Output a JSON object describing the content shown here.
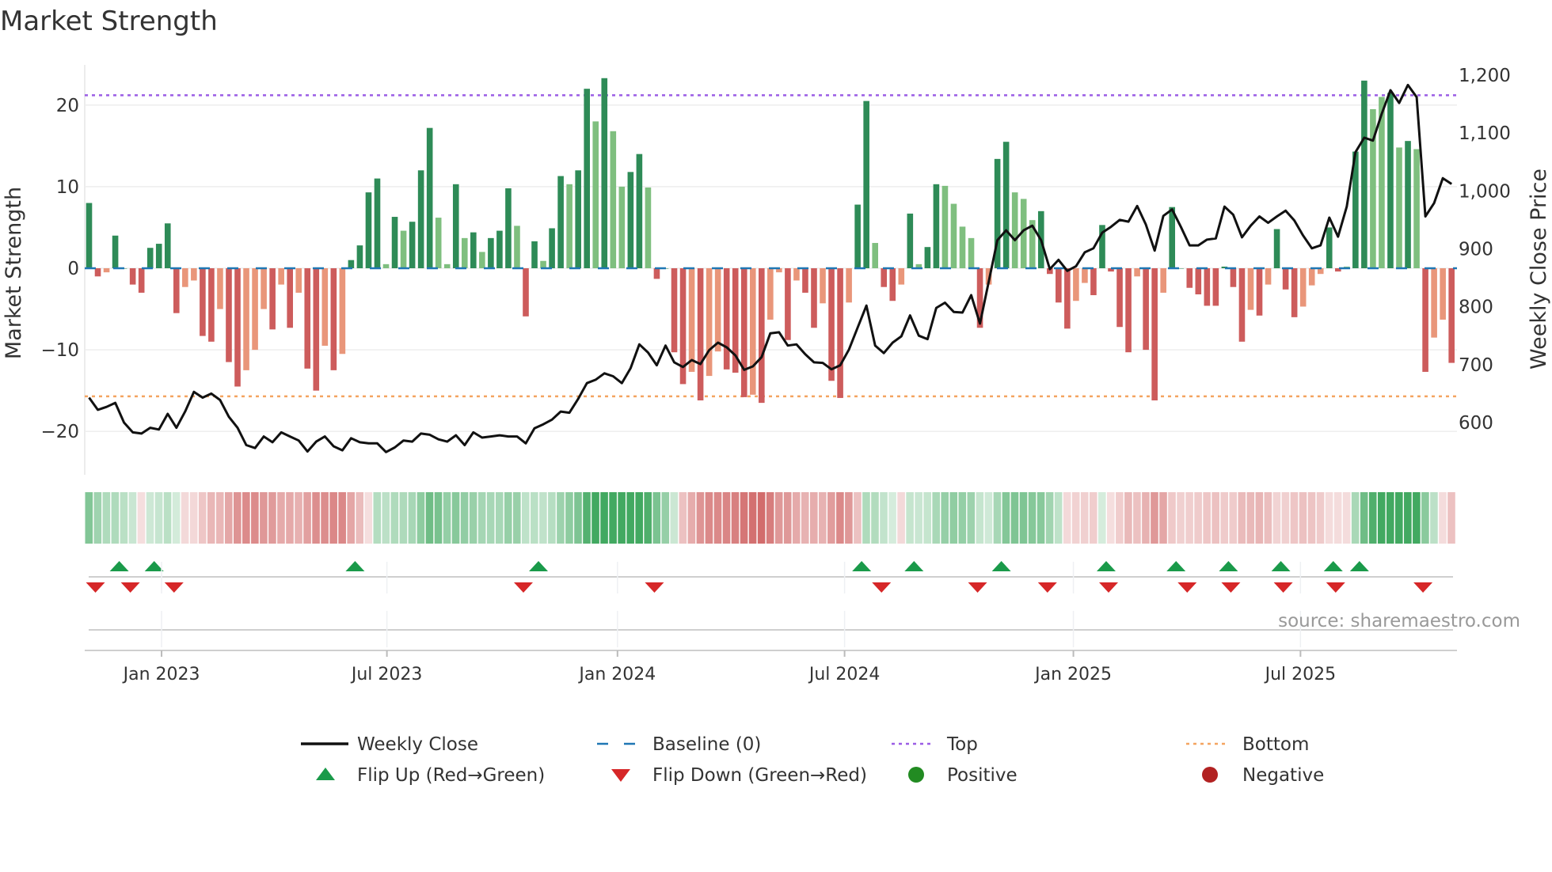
{
  "chart_data": {
    "type": "bar",
    "title": "Market Strength",
    "ylabel": "Market Strength",
    "y2label": "Weekly Close Price",
    "ylim": [
      -25,
      24
    ],
    "y2lim": [
      520,
      1223
    ],
    "yticks": [
      {
        "v": -20,
        "label": "−20"
      },
      {
        "v": -10,
        "label": "−10"
      },
      {
        "v": 0,
        "label": "0"
      },
      {
        "v": 10,
        "label": "10"
      },
      {
        "v": 20,
        "label": "20"
      }
    ],
    "y2ticks": [
      {
        "v": 600,
        "label": "600"
      },
      {
        "v": 700,
        "label": "700"
      },
      {
        "v": 800,
        "label": "800"
      },
      {
        "v": 900,
        "label": "900"
      },
      {
        "v": 1000,
        "label": "1,000"
      },
      {
        "v": 1100,
        "label": "1,100"
      },
      {
        "v": 1200,
        "label": "1,200"
      }
    ],
    "xticks": [
      {
        "week": 8.3,
        "label": "Jan 2023"
      },
      {
        "week": 34.1,
        "label": "Jul 2023"
      },
      {
        "week": 60.5,
        "label": "Jan 2024"
      },
      {
        "week": 86.5,
        "label": "Jul 2024"
      },
      {
        "week": 112.7,
        "label": "Jan 2025"
      },
      {
        "week": 138.7,
        "label": "Jul 2025"
      }
    ],
    "top_level": 21.2,
    "bottom_level": -15.7,
    "baseline": 0,
    "strength": [
      8,
      -1,
      -0.5,
      4,
      0,
      -2,
      -3,
      2.5,
      3,
      5.5,
      -5.5,
      -2.3,
      -1.5,
      -8.3,
      -9,
      -5,
      -11.5,
      -14.5,
      -12.5,
      -10,
      -5,
      -7.5,
      -2,
      -7.3,
      -3,
      -12.3,
      -15,
      -9.5,
      -12.5,
      -10.5,
      1,
      2.8,
      9.3,
      11,
      0.5,
      6.3,
      4.6,
      5.7,
      12,
      17.2,
      6.2,
      0.5,
      10.3,
      3.7,
      4.4,
      2,
      3.7,
      4.6,
      9.8,
      5.2,
      -5.9,
      3.3,
      0.9,
      4.9,
      11.3,
      10.3,
      12,
      22,
      18,
      23.3,
      16.8,
      10,
      11.8,
      14,
      9.9,
      -1.3,
      0,
      -10.3,
      -14.2,
      -12.7,
      -16.2,
      -13.2,
      -10.2,
      -12.4,
      -12.8,
      -15.8,
      -15.5,
      -16.5,
      -6.3,
      -0.5,
      -8.8,
      -1.5,
      -3,
      -7.3,
      -4.3,
      -13.8,
      -15.9,
      -4.2,
      7.8,
      20.5,
      3.1,
      -2.3,
      -4,
      -2,
      6.7,
      0.5,
      2.6,
      10.3,
      10.1,
      7.9,
      5.1,
      3.7,
      -7.3,
      -2,
      13.4,
      15.5,
      9.3,
      8.5,
      5.9,
      7,
      -0.7,
      -4.2,
      -7.4,
      -4,
      -1.8,
      -3.3,
      5.3,
      -0.4,
      -7.2,
      -10.3,
      -1,
      -10,
      -16.2,
      -3,
      7.5,
      0,
      -2.4,
      -3.2,
      -4.6,
      -4.6,
      0.2,
      -2.3,
      -9,
      -5.1,
      -5.8,
      -2,
      4.8,
      -2.6,
      -6,
      -4.7,
      -2.1,
      -0.7,
      5,
      -0.4,
      0.2,
      14.3,
      23,
      19.5,
      21,
      21.5,
      14.8,
      15.6,
      14.6,
      -12.7,
      -8.5,
      -6.3,
      -11.6
    ],
    "strong": [
      1,
      1,
      0,
      1,
      1,
      1,
      1,
      1,
      1,
      1,
      1,
      0,
      0,
      1,
      1,
      0,
      1,
      1,
      0,
      0,
      0,
      1,
      0,
      1,
      0,
      1,
      1,
      0,
      1,
      0,
      1,
      1,
      1,
      1,
      0,
      1,
      0,
      1,
      1,
      1,
      0,
      0,
      1,
      0,
      1,
      0,
      1,
      1,
      1,
      0,
      1,
      1,
      0,
      1,
      1,
      0,
      1,
      1,
      0,
      1,
      0,
      0,
      1,
      1,
      0,
      1,
      1,
      1,
      1,
      0,
      1,
      0,
      0,
      1,
      1,
      1,
      0,
      1,
      0,
      0,
      1,
      0,
      1,
      1,
      0,
      1,
      1,
      0,
      1,
      1,
      0,
      1,
      1,
      0,
      1,
      0,
      1,
      1,
      0,
      0,
      0,
      0,
      1,
      0,
      1,
      1,
      0,
      0,
      0,
      1,
      1,
      1,
      1,
      0,
      0,
      1,
      1,
      1,
      1,
      1,
      0,
      1,
      1,
      0,
      1,
      1,
      1,
      1,
      1,
      1,
      1,
      1,
      1,
      0,
      1,
      0,
      1,
      1,
      1,
      0,
      0,
      0,
      1,
      1,
      0,
      1,
      1,
      0,
      0,
      1,
      0,
      1,
      0,
      1,
      0,
      0,
      1
    ],
    "weekly_close": [
      643,
      622,
      627,
      634,
      600,
      583,
      581,
      591,
      588,
      615,
      591,
      619,
      653,
      643,
      650,
      639,
      610,
      591,
      561,
      556,
      576,
      566,
      583,
      576,
      569,
      550,
      567,
      576,
      559,
      552,
      573,
      566,
      564,
      564,
      549,
      557,
      569,
      567,
      581,
      579,
      571,
      567,
      578,
      561,
      583,
      574,
      576,
      578,
      576,
      576,
      564,
      590,
      597,
      605,
      619,
      617,
      641,
      668,
      674,
      685,
      680,
      668,
      694,
      735,
      721,
      699,
      733,
      704,
      696,
      708,
      701,
      725,
      738,
      730,
      716,
      691,
      697,
      713,
      754,
      756,
      733,
      735,
      718,
      704,
      703,
      692,
      699,
      726,
      764,
      802,
      733,
      720,
      738,
      749,
      785,
      750,
      744,
      798,
      807,
      791,
      790,
      820,
      771,
      843,
      915,
      932,
      915,
      932,
      940,
      915,
      865,
      881,
      862,
      870,
      894,
      901,
      928,
      938,
      950,
      947,
      974,
      942,
      897,
      957,
      968,
      938,
      906,
      906,
      916,
      918,
      973,
      959,
      920,
      940,
      956,
      945,
      956,
      966,
      949,
      923,
      901,
      906,
      954,
      921,
      973,
      1067,
      1092,
      1087,
      1133,
      1174,
      1152,
      1183,
      1162,
      956,
      979,
      1022,
      1012
    ],
    "flip_up_weeks": [
      3,
      7,
      30,
      51,
      88,
      94,
      104,
      116,
      124,
      130,
      136,
      142,
      145
    ],
    "flip_down_weeks": [
      1,
      5,
      10,
      50,
      65,
      91,
      102,
      110,
      117,
      126,
      131,
      137,
      143,
      153
    ],
    "legend": [
      {
        "label": "Weekly Close",
        "kind": "line"
      },
      {
        "label": "Baseline (0)",
        "kind": "dash"
      },
      {
        "label": "Top",
        "kind": "dot-top"
      },
      {
        "label": "Bottom",
        "kind": "dot-bottom"
      },
      {
        "label": "Flip Up (Red→Green)",
        "kind": "tri-up"
      },
      {
        "label": "Flip Down (Green→Red)",
        "kind": "tri-down"
      },
      {
        "label": "Positive",
        "kind": "dot-pos"
      },
      {
        "label": "Negative",
        "kind": "dot-neg"
      }
    ],
    "legend_placement": "bottom",
    "grid": true,
    "source": "source: sharemaestro.com"
  },
  "colors": {
    "strong_pos": "#2e8b57",
    "weak_pos": "#7fbf7f",
    "strong_neg": "#cd5c5c",
    "weak_neg": "#e9967a",
    "line": "#111111",
    "baseline": "#1f77b4",
    "top": "#9b5de5",
    "bottom": "#f4a460",
    "flip_up": "#1a9a4a",
    "flip_down": "#d62728",
    "positive": "#228b22",
    "negative": "#b22222"
  }
}
